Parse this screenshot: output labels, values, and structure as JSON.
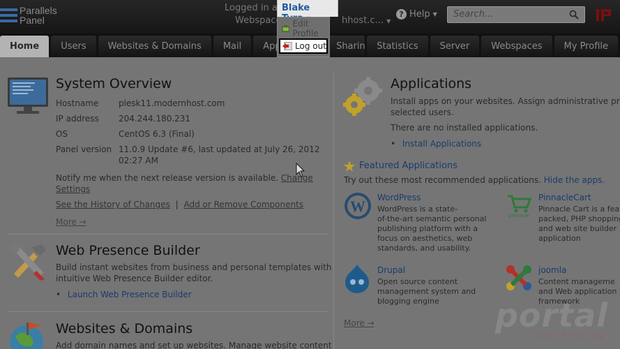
{
  "brand": {
    "line1": "Parallels",
    "line2": "Panel"
  },
  "header": {
    "logged_in_label": "Logged in as",
    "webspace_label": "Webspace",
    "webspace_value": "hhost.c...",
    "help_label": "Help",
    "search_placeholder": "Search..."
  },
  "user_menu": {
    "name": "Blake Tyra",
    "items": [
      {
        "label": "Edit Profile"
      },
      {
        "label": "Log out"
      }
    ]
  },
  "tabs": [
    "Home",
    "Users",
    "Websites & Domains",
    "Mail",
    "Applications",
    "Sharing",
    "Statistics",
    "Server",
    "Webspaces",
    "My Profile"
  ],
  "system_overview": {
    "title": "System Overview",
    "rows": [
      {
        "label": "Hostname",
        "value": "plesk11.modernhost.com"
      },
      {
        "label": "IP address",
        "value": "204.244.180.231"
      },
      {
        "label": "OS",
        "value": "CentOS 6.3 (Final)"
      },
      {
        "label": "Panel version",
        "value": "11.0.9 Update #6, last updated at July 26, 2012",
        "value2": "02:27 AM"
      }
    ],
    "notify_text": "Notify me when the next release version is available.",
    "change_link_1": "Change",
    "change_link_2": "Settings",
    "history_link": "See the History of Changes",
    "separator": "|",
    "components_link": "Add or Remove Components",
    "more": "More →"
  },
  "web_presence": {
    "title": "Web Presence Builder",
    "desc1": "Build instant websites from business and personal templates with",
    "desc2": "intuitive Web Presence Builder editor.",
    "link": "Launch Web Presence Builder"
  },
  "websites_domains": {
    "title": "Websites & Domains",
    "desc": "Add domain names and set up websites. Manage website content"
  },
  "applications": {
    "title": "Applications",
    "desc1": "Install apps on your websites. Assign administrative privi",
    "desc2": "selected users.",
    "none": "There are no installed applications.",
    "install_link": "Install Applications",
    "featured_title": "Featured Applications",
    "try_text": "Try out these most recommended applications.",
    "hide_link": "Hide the apps.",
    "more": "More →",
    "apps": [
      {
        "name": "WordPress",
        "desc": [
          "WordPress is a state-",
          "of-the-art semantic personal",
          "publishing platform with a",
          "focus on aesthetics, web",
          "standards, and usability."
        ]
      },
      {
        "name": "PinnacleCart",
        "desc": [
          "Pinnacle Cart is a feat",
          "packed, PHP shopping",
          "and web site builder",
          "application"
        ]
      },
      {
        "name": "Drupal",
        "desc": [
          "Open source content",
          "management system and",
          "blogging engine"
        ]
      },
      {
        "name": "joomla",
        "desc": [
          "Content manageme",
          "and Web application",
          "framework"
        ]
      }
    ]
  },
  "watermark": {
    "main": "portal",
    "sub": "web hosting"
  }
}
